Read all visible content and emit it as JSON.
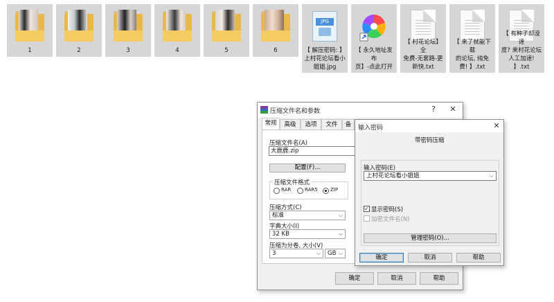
{
  "desktop": {
    "folders": [
      {
        "label": "1"
      },
      {
        "label": "2"
      },
      {
        "label": "3"
      },
      {
        "label": "4"
      },
      {
        "label": "5"
      },
      {
        "label": "6"
      }
    ],
    "files": [
      {
        "label": "【 解压密码: 】\n上村花论坛看小\n姐姐.jpg",
        "badge": "JPG"
      },
      {
        "label": "【 永久地址发布\n页】-点此打开"
      },
      {
        "label": "【 村花论坛】全\n免费-无套路-更\n新快.txt"
      },
      {
        "label": "【 来了就能下载\n的论坛, 纯免\n费! 】.txt"
      },
      {
        "label": "【 有种子却没速\n度? 来村花论坛\n人工加速! 】.txt"
      }
    ]
  },
  "archive_dialog": {
    "title": "压缩文件名和参数",
    "help_glyph": "?",
    "close_glyph": "✕",
    "tabs": [
      "常规",
      "高级",
      "选项",
      "文件",
      "备"
    ],
    "archive_name_label": "压缩文件名(A)",
    "archive_name_value": "大鹿鹿.zip",
    "config_button": "配置(F)...",
    "format_group_label": "压缩文件格式",
    "formats": [
      "RAR",
      "RAR5",
      "ZIP"
    ],
    "selected_format": "ZIP",
    "method_label": "压缩方式(C)",
    "method_value": "标准",
    "dict_label": "字典大小(I)",
    "dict_value": "32 KB",
    "split_label": "压缩为分卷, 大小(V)",
    "split_value": "3",
    "split_unit": "GB",
    "ok": "确定",
    "cancel": "取消",
    "help": "帮助"
  },
  "password_dialog": {
    "title": "输入密码",
    "close_glyph": "✕",
    "subtitle": "带密码压缩",
    "password_label": "输入密码(E)",
    "password_value": "上村花论坛看小姐姐",
    "show_password_label": "显示密码(S)",
    "show_password_checked": true,
    "encrypt_names_label": "加密文件名(N)",
    "encrypt_names_checked": false,
    "manage_button": "管理密码(O)...",
    "ok": "确定",
    "cancel": "取消",
    "help": "帮助"
  },
  "colors": {
    "folder": "#e8b94a",
    "accent": "#3c7fb1"
  }
}
